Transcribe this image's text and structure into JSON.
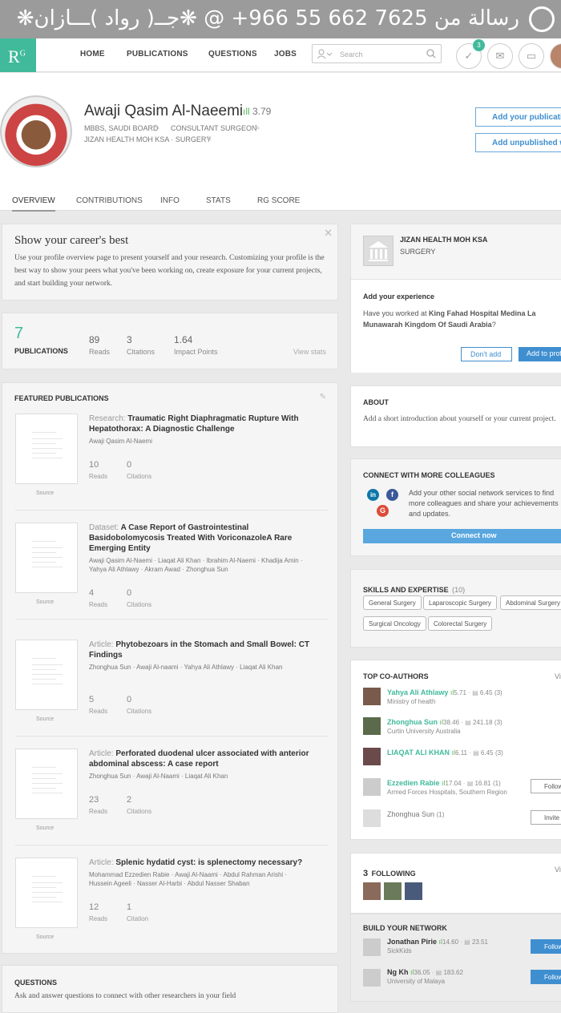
{
  "banner": {
    "text": "رسالة من 7625 662 55 966+ @ ❋جــ( رواد )ـــازان❋"
  },
  "nav": {
    "logo": "R",
    "logo_sup": "G",
    "items": [
      "HOME",
      "PUBLICATIONS",
      "QUESTIONS",
      "JOBS"
    ],
    "search_placeholder": "Search",
    "notif_count": "3"
  },
  "profile": {
    "name": "Awaji Qasim Al-Naeemi",
    "rg_score": "3.79",
    "degree": "MBBS, SAUDI BOARD",
    "position": "CONSULTANT SURGEON",
    "institution": "JIZAN HEALTH MOH KSA · SURGERY",
    "add_pubs": "Add your publications",
    "add_unpub": "Add unpublished work",
    "tabs": [
      "OVERVIEW",
      "CONTRIBUTIONS",
      "INFO",
      "STATS",
      "RG SCORE"
    ]
  },
  "career": {
    "title": "Show your career's best",
    "body": "Use your profile overview page to present yourself and your research. Customizing your profile is the best way to show your peers what you've been working on, create exposure for your current projects, and start building your network."
  },
  "stats": {
    "pubs": "7",
    "pubs_label": "PUBLICATIONS",
    "reads": "89",
    "reads_label": "Reads",
    "cites": "3",
    "cites_label": "Citations",
    "impact": "1.64",
    "impact_label": "Impact Points",
    "view": "View stats"
  },
  "featured": {
    "heading": "FEATURED PUBLICATIONS",
    "source": "Source",
    "items": [
      {
        "type": "Research:",
        "title": "Traumatic Right Diaphragmatic Rupture With Hepatothorax: A Diagnostic Challenge",
        "authors": "Awaji Qasim Al-Naemi",
        "reads": "10",
        "cites": "0",
        "reads_label": "Reads",
        "cites_label": "Citations"
      },
      {
        "type": "Dataset:",
        "title": "A Case Report of Gastrointestinal Basidobolomycosis Treated With VoriconazoleA Rare Emerging Entity",
        "authors": "Awaji Qasim Al-Naemi · Liaqat Ali Khan · Ibrahim Al-Naemi · Khadija Amin · Yahya Ali Athlawy · Akram Awad · Zhonghua Sun",
        "reads": "4",
        "cites": "0",
        "reads_label": "Reads",
        "cites_label": "Citations"
      },
      {
        "type": "Article:",
        "title": "Phytobezoars in the Stomach and Small Bowel: CT Findings",
        "authors": "Zhonghua Sun · Awaji Al-naami · Yahya Ali Athlawy · Liaqat Ali Khan",
        "reads": "5",
        "cites": "0",
        "reads_label": "Reads",
        "cites_label": "Citations"
      },
      {
        "type": "Article:",
        "title": "Perforated duodenal ulcer associated with anterior abdominal abscess: A case report",
        "authors": "Zhonghua Sun · Awaji Al-Naami · Liaqat Ali Khan",
        "reads": "23",
        "cites": "2",
        "reads_label": "Reads",
        "cites_label": "Citations"
      },
      {
        "type": "Article:",
        "title": "Splenic hydatid cyst: is splenectomy necessary?",
        "authors": "Mohammad Ezzedien Rabie · Awaji Al-Naami · Abdul Rahman Arishi · Hussein Ageeli · Nasser Al-Harbi · Abdul Nasser Shaban",
        "reads": "12",
        "cites": "1",
        "reads_label": "Reads",
        "cites_label": "Citation"
      }
    ]
  },
  "questions": {
    "heading": "QUESTIONS",
    "body": "Ask and answer questions to connect with other researchers in your field"
  },
  "institution": {
    "name": "JIZAN HEALTH MOH KSA",
    "dept": "SURGERY",
    "exp_title": "Add your experience",
    "exp_q1": "Have you worked at ",
    "exp_place": "King Fahad Hospital Medina La Munawarah Kingdom Of Saudi Arabia",
    "exp_q2": "?",
    "dont": "Don't add",
    "add": "Add to profile"
  },
  "about": {
    "heading": "ABOUT",
    "body": "Add a short introduction about yourself or your current project."
  },
  "connect": {
    "heading": "CONNECT WITH MORE COLLEAGUES",
    "body": "Add your other social network services to find more colleagues and share your achievements and updates.",
    "button": "Connect now"
  },
  "skills": {
    "heading": "SKILLS AND EXPERTISE",
    "count": "(10)",
    "items": [
      "General Surgery",
      "Laparoscopic Surgery",
      "Abdominal Surgery",
      "Surgical Oncology",
      "Colorectal Surgery"
    ]
  },
  "coauthors": {
    "heading": "TOP CO-AUTHORS",
    "view": "View all",
    "follow": "Follow",
    "invite": "Invite",
    "items": [
      {
        "name": "Yahya Ali Athlawy",
        "score": "5.71",
        "ip": "6.45",
        "n": "(3)",
        "sub": "Ministry of health"
      },
      {
        "name": "Zhonghua Sun",
        "score": "38.46",
        "ip": "241.18",
        "n": "(3)",
        "sub": "Curtin University Australia"
      },
      {
        "name": "LIAQAT ALI KHAN",
        "score": "6.11",
        "ip": "6.45",
        "n": "(3)",
        "sub": ""
      },
      {
        "name": "Ezzedien Rabie",
        "score": "17.04",
        "ip": "16.81",
        "n": "(1)",
        "sub": "Armed Forces Hospitals, Southern Region"
      },
      {
        "name": "Zhonghua Sun",
        "score": "",
        "ip": "",
        "n": "(1)",
        "sub": ""
      }
    ]
  },
  "following": {
    "count": "3",
    "label": "FOLLOWING",
    "view": "View all"
  },
  "network": {
    "heading": "BUILD YOUR NETWORK",
    "follow": "Follow",
    "items": [
      {
        "name": "Jonathan Pirie",
        "score": "14.60",
        "ip": "23.51",
        "sub": "SickKids"
      },
      {
        "name": "Ng Kh",
        "score": "36.05",
        "ip": "183.62",
        "sub": "University of Malaya"
      }
    ]
  }
}
